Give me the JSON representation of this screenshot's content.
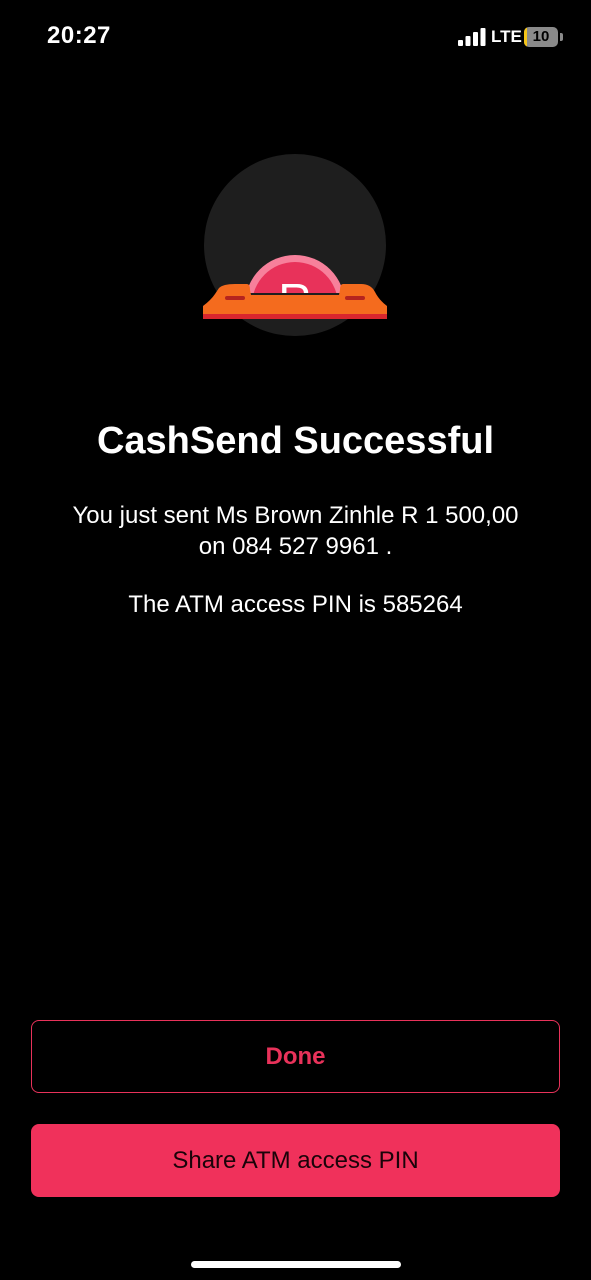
{
  "status_bar": {
    "time": "20:27",
    "network": "LTE",
    "battery_level": "10",
    "battery_fraction": 0.1,
    "battery_fill_color": "#f5c518",
    "icons": [
      "signal-icon",
      "battery-icon"
    ]
  },
  "illustration": {
    "icon": "cash-slot-icon",
    "symbol": "R",
    "colors": {
      "circle": "#1e1e1e",
      "slot": "#f46b1e",
      "coin": "#e8325a",
      "coin_rim": "#f7809b"
    }
  },
  "content": {
    "title": "CashSend Successful",
    "message_line1": "You just sent Ms Brown Zinhle R 1 500,00",
    "message_line2": "on 084 527 9961 .",
    "pin_text": "The ATM access PIN is 585264"
  },
  "actions": {
    "done_label": "Done",
    "share_label": "Share ATM access PIN"
  },
  "colors": {
    "accent": "#f0315b",
    "background": "#000000"
  }
}
